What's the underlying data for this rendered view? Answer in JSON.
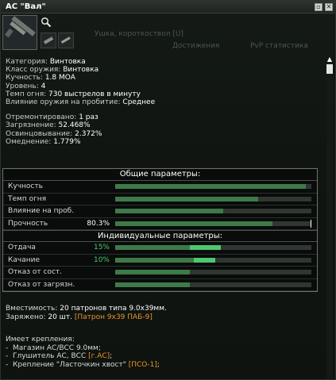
{
  "window": {
    "title": "АС \"Вал\"",
    "minimize_glyph": "▫",
    "close_glyph": "✕"
  },
  "background": {
    "tab_hint": "Ушка, короткоствол [U]",
    "tabs": [
      "Достижения",
      "PvP статистика"
    ]
  },
  "info": {
    "category_label": "Категория:",
    "category": "Винтовка",
    "class_label": "Класс оружия:",
    "class": "Винтовка",
    "accuracy_label": "Кучность:",
    "accuracy": "1.8 MOA",
    "level_label": "Уровень:",
    "level": "4",
    "fire_rate_label": "Темп огня:",
    "fire_rate": "730 выстрелов в минуту",
    "penetration_label": "Влияние оружия на пробитие:",
    "penetration": "Среднее",
    "repaired_label": "Отремонтировано:",
    "repaired": "1 раз",
    "fouling_label": "Загрязнение:",
    "fouling": "52.468%",
    "leading_label": "Освинцовывание:",
    "leading": "2.372%",
    "copper_label": "Омеднение:",
    "copper": "1.779%"
  },
  "params": {
    "general_title": "Общие параметры:",
    "individual_title": "Индивидуальные параметры:",
    "general": [
      {
        "label": "Кучность",
        "value": "",
        "fill": 0.97
      },
      {
        "label": "Темп огня",
        "value": "",
        "fill": 0.73
      },
      {
        "label": "Влияние на проб.",
        "value": "",
        "fill": 0.55
      },
      {
        "label": "Прочность",
        "value": "80.3%",
        "fill": 0.803
      }
    ],
    "individual": [
      {
        "label": "Отдача",
        "value": "15%",
        "fill": 0.38,
        "hi_start": 0.38,
        "hi_end": 0.54,
        "value_color": "#4fc670"
      },
      {
        "label": "Качание",
        "value": "10%",
        "fill": 0.4,
        "hi_start": 0.4,
        "hi_end": 0.51,
        "value_color": "#4fc670"
      },
      {
        "label": "Отказ от сост.",
        "value": "",
        "fill": 0.38
      },
      {
        "label": "Отказ от загрязн.",
        "value": "",
        "fill": 0.38
      }
    ]
  },
  "magazine": {
    "capacity_label": "Вместимость:",
    "capacity": "20 патронов типа 9.0x39мм.",
    "loaded_label": "Заряжено:",
    "loaded": "20 шт.",
    "loaded_ammo": "[Патрон 9х39 ПАБ-9]"
  },
  "mounts": {
    "title": "Имеет крепления:",
    "items": [
      {
        "text": "-  Магазин АС/ВСС 9.0мм;",
        "tag": "",
        "suffix": ""
      },
      {
        "text": "-  Глушитель АС, ВСС ",
        "tag": "[г.АС]",
        "suffix": ";"
      },
      {
        "text": "-  Крепление \"Ласточкин хвост\" ",
        "tag": "[ПСО-1]",
        "suffix": ";"
      }
    ]
  },
  "colors": {
    "accent_orange": "#e8962a",
    "bar_fill": "#3e7a48",
    "bar_highlight": "#4fc670"
  },
  "icons": {
    "zoom": "magnifier-icon",
    "scroll_up": "arrow-up-icon"
  }
}
